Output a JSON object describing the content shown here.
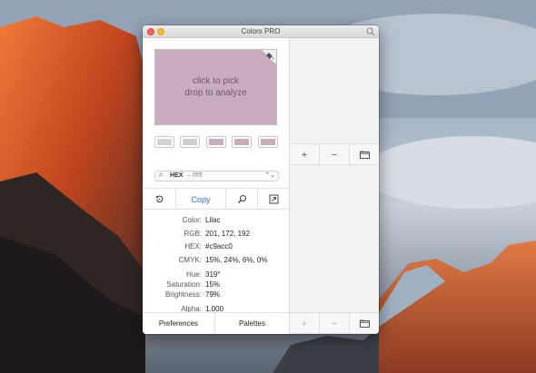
{
  "window": {
    "title": "Colors PRO"
  },
  "picker": {
    "line1": "click to pick",
    "line2": "drop to analyze",
    "color": "#c9acc0"
  },
  "swatches": [
    "#d3d3d3",
    "#cfcfcf",
    "#c9acc0",
    "#c9acc0",
    "#c9acc0"
  ],
  "format_select": {
    "hash": "#",
    "format": "HEX",
    "value": "– ffffff",
    "arrows": "⌃⌄"
  },
  "actions": {
    "copy_label": "Copy"
  },
  "color_info": {
    "color": {
      "label": "Color:",
      "value": "Lilac"
    },
    "rgb": {
      "label": "RGB:",
      "value": "201, 172, 192"
    },
    "hex": {
      "label": "HEX:",
      "value": "#c9acc0"
    },
    "cmyk": {
      "label": "CMYK:",
      "value": "15%, 24%, 6%, 0%"
    },
    "hue": {
      "label": "Hue:",
      "value": "319°"
    },
    "saturation": {
      "label": "Saturation:",
      "value": "15%"
    },
    "brightness": {
      "label": "Brightness:",
      "value": "79%"
    },
    "alpha": {
      "label": "Alpha:",
      "value": "1.000"
    }
  },
  "footer": {
    "preferences_label": "Preferences",
    "palettes_label": "Palettes"
  },
  "palette_bar": {
    "add": "+",
    "remove": "−"
  }
}
